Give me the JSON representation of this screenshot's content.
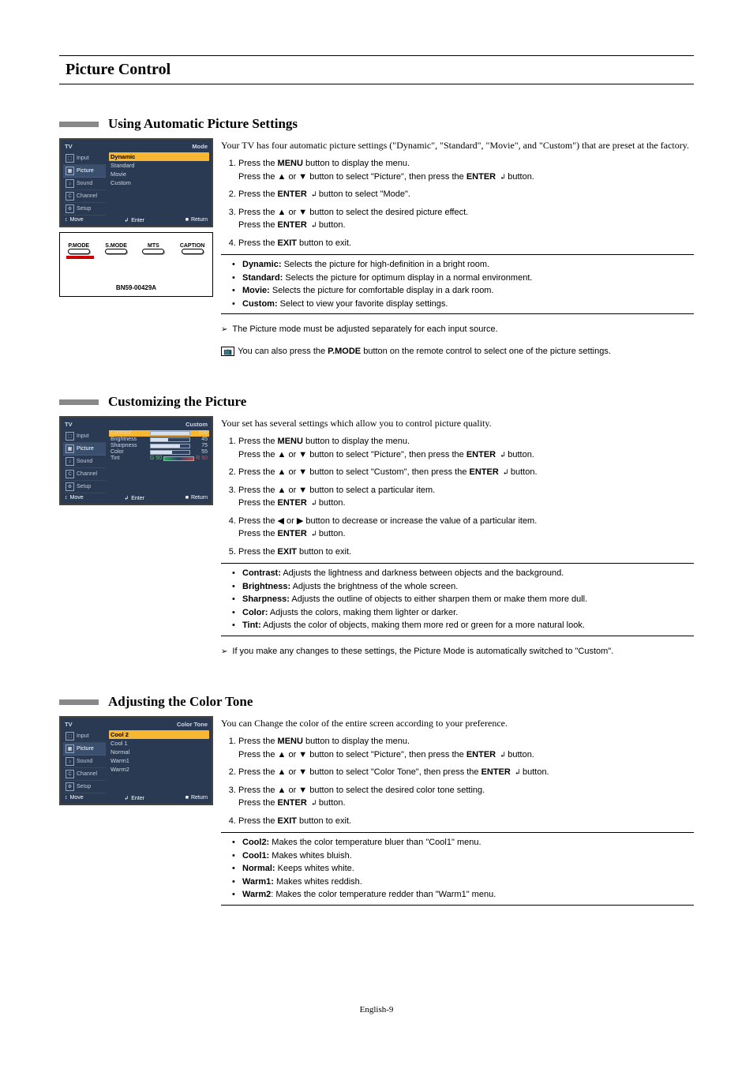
{
  "page": {
    "title": "Picture Control",
    "footer": "English-9"
  },
  "sections": [
    {
      "title": "Using Automatic Picture Settings",
      "intro": "Your TV has four automatic picture settings (\"Dynamic\", \"Standard\", \"Movie\", and \"Custom\") that are preset at the factory.",
      "steps": [
        "Press the MENU button to display the menu.\nPress the ▲ or ▼ button to select \"Picture\", then press the ENTER ↵ button.",
        "Press the ENTER ↵ button to select \"Mode\".",
        "Press the ▲ or ▼ button to select the desired picture effect.\nPress the ENTER ↵ button.",
        "Press the EXIT button to exit."
      ],
      "notes": [
        "Dynamic: Selects the picture for high-definition in a bright room.",
        "Standard: Selects the picture for optimum display in a normal environment.",
        "Movie: Selects the picture for comfortable display in a dark room.",
        "Custom: Select to view your favorite display settings."
      ],
      "noteLeads": [
        "Dynamic:",
        "Standard:",
        "Movie:",
        "Custom:"
      ],
      "extra": [
        {
          "type": "arrow",
          "text": "The Picture mode must be adjusted separately for each input source."
        },
        {
          "type": "remote",
          "text": "You can also press the P.MODE button on the remote control to select one of the picture settings."
        }
      ],
      "osd": {
        "tv": "TV",
        "badge": "Mode",
        "sidebar": [
          "Input",
          "Picture",
          "Sound",
          "Channel",
          "Setup"
        ],
        "items": [
          "Dynamic",
          "Standard",
          "Movie",
          "Custom"
        ],
        "highlight": 0,
        "foot": [
          "Move",
          "Enter",
          "Return"
        ]
      },
      "remote": {
        "captions": [
          "P.MODE",
          "S.MODE",
          "MTS",
          "CAPTION"
        ],
        "label": "BN59-00429A"
      }
    },
    {
      "title": "Customizing the Picture",
      "intro": "Your set has several settings which allow you to control picture quality.",
      "steps": [
        "Press the MENU button to display the menu.\nPress the ▲ or ▼ button to select \"Picture\", then press the ENTER ↵ button.",
        "Press the ▲ or ▼ button to select \"Custom\", then press the ENTER ↵ button.",
        "Press the ▲ or ▼ button to select a particular item.\nPress the ENTER ↵ button.",
        "Press the ◀ or ▶ button to decrease or increase the value of a particular item.\nPress the ENTER ↵ button.",
        "Press the EXIT button to exit."
      ],
      "notes": [
        "Contrast: Adjusts the lightness and darkness between objects and the background.",
        "Brightness: Adjusts the brightness of the whole screen.",
        "Sharpness: Adjusts the outline of objects to either sharpen them or make them more dull.",
        "Color: Adjusts the colors, making them lighter or darker.",
        "Tint: Adjusts the color of objects, making them more red or green for a more natural look."
      ],
      "noteLeads": [
        "Contrast:",
        "Brightness:",
        "Sharpness:",
        "Color:",
        "Tint:"
      ],
      "extra": [
        {
          "type": "arrow",
          "text": "If you make any changes to these settings, the Picture Mode is automatically switched to \"Custom\"."
        }
      ],
      "osd": {
        "tv": "TV",
        "badge": "Custom",
        "sidebar": [
          "Input",
          "Picture",
          "Sound",
          "Channel",
          "Setup"
        ],
        "sliders": [
          {
            "label": "Contrast",
            "val": "100",
            "pct": 100
          },
          {
            "label": "Brightness",
            "val": "45",
            "pct": 45
          },
          {
            "label": "Sharpness",
            "val": "75",
            "pct": 75
          },
          {
            "label": "Color",
            "val": "55",
            "pct": 55
          }
        ],
        "tint": {
          "label": "Tint",
          "g": "G 50",
          "r": "R 50"
        },
        "foot": [
          "Move",
          "Enter",
          "Return"
        ]
      }
    },
    {
      "title": "Adjusting the Color Tone",
      "intro": "You can Change the color of the entire screen according to your preference.",
      "steps": [
        "Press the MENU button to display the menu.\nPress the ▲ or ▼ button to select \"Picture\", then press the ENTER ↵ button.",
        "Press the ▲ or ▼ button to select \"Color Tone\", then press the ENTER ↵ button.",
        "Press the ▲ or ▼ button to select the desired color tone setting.\nPress the ENTER ↵ button.",
        "Press the EXIT button to exit."
      ],
      "notes": [
        "Cool2: Makes the color temperature bluer than \"Cool1\" menu.",
        "Cool1: Makes whites bluish.",
        "Normal: Keeps whites white.",
        "Warm1: Makes whites reddish.",
        "Warm2: Makes the color temperature redder than \"Warm1\" menu."
      ],
      "noteLeads": [
        "Cool2:",
        "Cool1:",
        "Normal:",
        "Warm1:",
        "Warm2"
      ],
      "extra": [],
      "osd": {
        "tv": "TV",
        "badge": "Color Tone",
        "sidebar": [
          "Input",
          "Picture",
          "Sound",
          "Channel",
          "Setup"
        ],
        "items": [
          "Cool 2",
          "Cool 1",
          "Normal",
          "Warm1",
          "Warm2"
        ],
        "highlight": 0,
        "foot": [
          "Move",
          "Enter",
          "Return"
        ]
      }
    }
  ]
}
